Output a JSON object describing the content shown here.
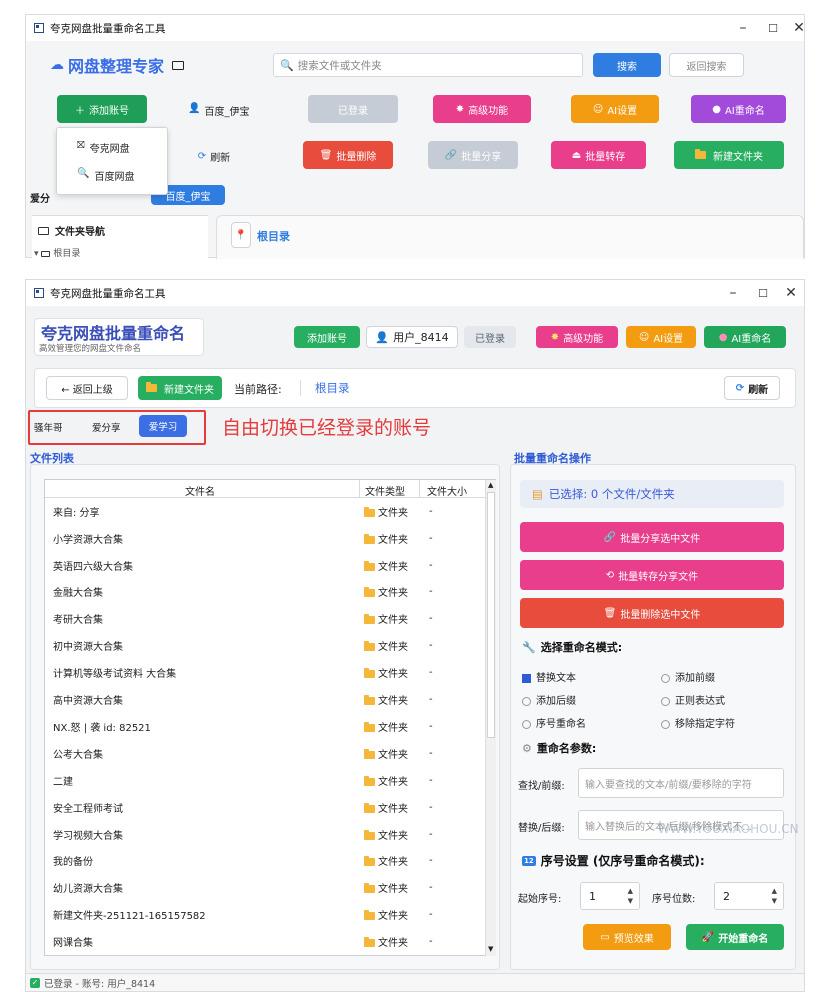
{
  "top": {
    "title": "夸克网盘批量重命名工具",
    "brand": "网盘整理专家",
    "search_placeholder": "搜索文件或文件夹",
    "search_btn": "搜索",
    "back_search_btn": "返回搜索",
    "add_account_btn": "添加账号",
    "user": "百度_伊宝",
    "logged_btn": "已登录",
    "advanced_btn": "高级功能",
    "ai_settings_btn": "AI设置",
    "ai_rename_btn": "AI重命名",
    "dropdown": [
      "夸克网盘",
      "百度网盘"
    ],
    "refresh_btn": "刷新",
    "batch_delete_btn": "批量删除",
    "batch_share_btn": "批量分享",
    "batch_transfer_btn": "批量转存",
    "new_folder_btn": "新建文件夹",
    "love_label": "爱分",
    "active_account_tab": "百度_伊宝",
    "folder_nav": "文件夹导航",
    "root_dir": "根目录",
    "root_tab": "根目录"
  },
  "main": {
    "title": "夸克网盘批量重命名工具",
    "brand": "夸克网盘批量重命名",
    "subtitle": "高效管理您的网盘文件命名",
    "add_account_btn": "添加账号",
    "user": "用户_8414",
    "logged_btn": "已登录",
    "advanced_btn": "高级功能",
    "ai_settings_btn": "AI设置",
    "ai_rename_btn": "AI重命名",
    "back_btn": "← 返回上级",
    "new_folder_btn": "新建文件夹",
    "current_path_label": "当前路径:",
    "current_path": "根目录",
    "refresh_btn": "刷新",
    "accounts": [
      "骚年哥",
      "爱分享",
      "爱学习"
    ],
    "annotation": "自由切换已经登录的账号",
    "file_list_title": "文件列表",
    "columns": [
      "文件名",
      "文件类型",
      "文件大小"
    ],
    "files": [
      {
        "name": "来自: 分享",
        "type": "文件夹",
        "size": "-"
      },
      {
        "name": "小学资源大合集",
        "type": "文件夹",
        "size": "-"
      },
      {
        "name": "英语四六级大合集",
        "type": "文件夹",
        "size": "-"
      },
      {
        "name": "金融大合集",
        "type": "文件夹",
        "size": "-"
      },
      {
        "name": "考研大合集",
        "type": "文件夹",
        "size": "-"
      },
      {
        "name": "初中资源大合集",
        "type": "文件夹",
        "size": "-"
      },
      {
        "name": "计算机等级考试资料 大合集",
        "type": "文件夹",
        "size": "-"
      },
      {
        "name": "高中资源大合集",
        "type": "文件夹",
        "size": "-"
      },
      {
        "name": "NX.怒 | 袭 id: 82521",
        "type": "文件夹",
        "size": "-"
      },
      {
        "name": "公考大合集",
        "type": "文件夹",
        "size": "-"
      },
      {
        "name": "二建",
        "type": "文件夹",
        "size": "-"
      },
      {
        "name": "安全工程师考试",
        "type": "文件夹",
        "size": "-"
      },
      {
        "name": "学习视频大合集",
        "type": "文件夹",
        "size": "-"
      },
      {
        "name": "我的备份",
        "type": "文件夹",
        "size": "-"
      },
      {
        "name": "幼儿资源大合集",
        "type": "文件夹",
        "size": "-"
      },
      {
        "name": "新建文件夹-251121-165157582",
        "type": "文件夹",
        "size": "-"
      },
      {
        "name": "网课合集",
        "type": "文件夹",
        "size": "-"
      }
    ],
    "batch_title": "批量重命名操作",
    "selected": "已选择: 0 个文件/文件夹",
    "batch_share": "批量分享选中文件",
    "batch_transfer": "批量转存分享文件",
    "batch_delete": "批量删除选中文件",
    "mode_title": "选择重命名模式:",
    "modes": [
      "替换文本",
      "添加前缀",
      "添加后缀",
      "正则表达式",
      "序号重命名",
      "移除指定字符"
    ],
    "params_title": "重命名参数:",
    "find_label": "查找/前缀:",
    "find_placeholder": "输入要查找的文本/前缀/要移除的字符",
    "replace_label": "替换/后缀:",
    "replace_placeholder": "输入替换后的文本/后缀(移除模式不...",
    "seq_title": "序号设置 (仅序号重命名模式):",
    "start_label": "起始序号:",
    "start_value": "1",
    "digits_label": "序号位数:",
    "digits_value": "2",
    "preview_btn": "预览效果",
    "start_btn": "开始重命名",
    "status": "已登录 - 账号: 用户_8414",
    "watermark": "WWW.YOUXIAOHOU.CN"
  }
}
